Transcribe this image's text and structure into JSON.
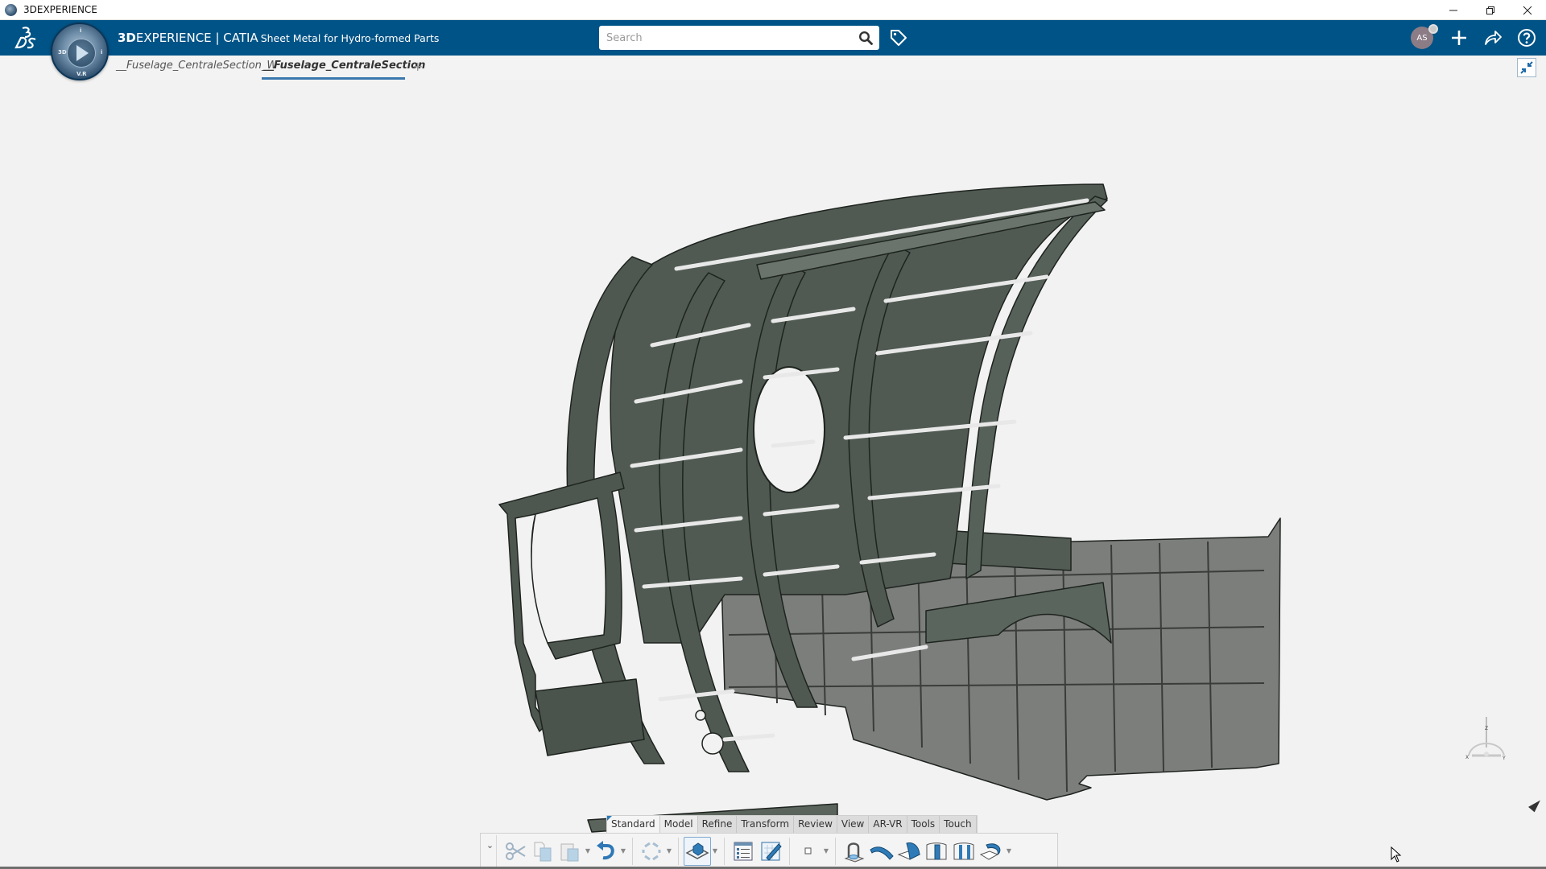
{
  "window": {
    "title": "3DEXPERIENCE",
    "controls": [
      "minimize",
      "restore",
      "close"
    ]
  },
  "topbar": {
    "brand_bold": "3D",
    "brand_rest": "EXPERIENCE",
    "separator": " | ",
    "app_name": "CATIA",
    "app_subtitle": "Sheet Metal for Hydro-formed Parts",
    "compass_labels": {
      "left": "3D",
      "bottom": "V.R",
      "top": "i",
      "right": "i"
    },
    "search": {
      "placeholder": "Search",
      "value": ""
    },
    "user_initials": "AS"
  },
  "tabs": [
    {
      "label": "__Fuselage_CentraleSection_W",
      "active": false
    },
    {
      "label": "__Fuselage_CentraleSection",
      "active": true
    }
  ],
  "tab_add_label": "+",
  "action_bar": {
    "tabs": [
      {
        "label": "Standard",
        "active": true
      },
      {
        "label": "Model",
        "active": false
      },
      {
        "label": "Refine",
        "active": false
      },
      {
        "label": "Transform",
        "active": false
      },
      {
        "label": "Review",
        "active": false
      },
      {
        "label": "View",
        "active": false
      },
      {
        "label": "AR-VR",
        "active": false
      },
      {
        "label": "Tools",
        "active": false
      },
      {
        "label": "Touch",
        "active": false
      }
    ],
    "collapse_glyph": "⌄",
    "tools": [
      "cut-icon",
      "copy-icon",
      "paste-icon",
      "undo-icon",
      "update-icon",
      "3d-model-icon",
      "tree-icon",
      "sketch-icon",
      "point-icon",
      "sheet-metal-parameters-icon",
      "hydro-formed-surface-icon",
      "web-icon",
      "hydro-flange-icon",
      "joggle-icon",
      "bend-flange-icon"
    ]
  },
  "viewport": {
    "model_name": "Fuselage central section",
    "compass_axes": {
      "x": "X",
      "y": "Y",
      "z": "Z"
    }
  },
  "colors": {
    "brand_blue": "#005386",
    "frame_green": "#4f5a52",
    "skin_gray": "#7c7e7c",
    "background": "#f2f2f2",
    "accent_underline": "#3a78ae"
  }
}
